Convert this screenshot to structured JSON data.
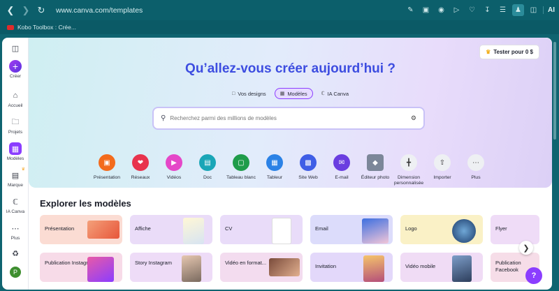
{
  "browser": {
    "url": "www.canva.com/templates",
    "ai_label": "AI",
    "bookmark": "Kobo Toolbox : Crée..."
  },
  "rail": {
    "create": "Créer",
    "home": "Accueil",
    "projects": "Projets",
    "templates": "Modèles",
    "brand": "Marque",
    "ai": "IA Canva",
    "more": "Plus",
    "avatar_initial": "P"
  },
  "header": {
    "trial": "Tester pour 0 $",
    "title": "Qu’allez-vous créer aujourd’hui ?",
    "tabs": [
      "Vos designs",
      "Modèles",
      "IA Canva"
    ],
    "search_placeholder": "Recherchez parmi des millions de modèles"
  },
  "categories": [
    {
      "label": "Présentation",
      "color": "#f36b1c",
      "icon": "presentation-icon"
    },
    {
      "label": "Réseaux",
      "color": "#e8334d",
      "icon": "heart-icon"
    },
    {
      "label": "Vidéos",
      "color": "#e547c8",
      "icon": "video-icon"
    },
    {
      "label": "Doc",
      "color": "#1aa6b7",
      "icon": "doc-icon"
    },
    {
      "label": "Tableau blanc",
      "color": "#1f9c4a",
      "icon": "whiteboard-icon"
    },
    {
      "label": "Tableur",
      "color": "#2b82e6",
      "icon": "spreadsheet-icon"
    },
    {
      "label": "Site Web",
      "color": "#3f5ee6",
      "icon": "website-icon"
    },
    {
      "label": "E-mail",
      "color": "#6a3de0",
      "icon": "email-icon"
    },
    {
      "label": "Éditeur photo",
      "color": "#7c8799",
      "icon": "photo-editor-icon"
    },
    {
      "label": "Dimension personnalisée",
      "color": "#eef0f3",
      "icon": "custom-size-icon"
    },
    {
      "label": "Importer",
      "color": "#eef0f3",
      "icon": "upload-icon"
    },
    {
      "label": "Plus",
      "color": "#eef0f3",
      "icon": "more-icon"
    }
  ],
  "section_title": "Explorer les modèles",
  "cards_row1": [
    {
      "label": "Présentation",
      "bg": "#fbdcd3"
    },
    {
      "label": "Affiche",
      "bg": "#eadcf8"
    },
    {
      "label": "CV",
      "bg": "#e9dcf9"
    },
    {
      "label": "Email",
      "bg": "#dcdcfb"
    },
    {
      "label": "Logo",
      "bg": "#faf1c6"
    },
    {
      "label": "Flyer",
      "bg": "#efdcf7"
    }
  ],
  "cards_row2": [
    {
      "label": "Publication Instagram",
      "bg": "#f7dbe8"
    },
    {
      "label": "Story Instagram",
      "bg": "#eedcf7"
    },
    {
      "label": "Vidéo en format...",
      "bg": "#f3dcef"
    },
    {
      "label": "Invitation",
      "bg": "#e3d8fa"
    },
    {
      "label": "Vidéo mobile",
      "bg": "#f0dcf5"
    },
    {
      "label": "Publication Facebook",
      "bg": "#f6dde8"
    }
  ]
}
